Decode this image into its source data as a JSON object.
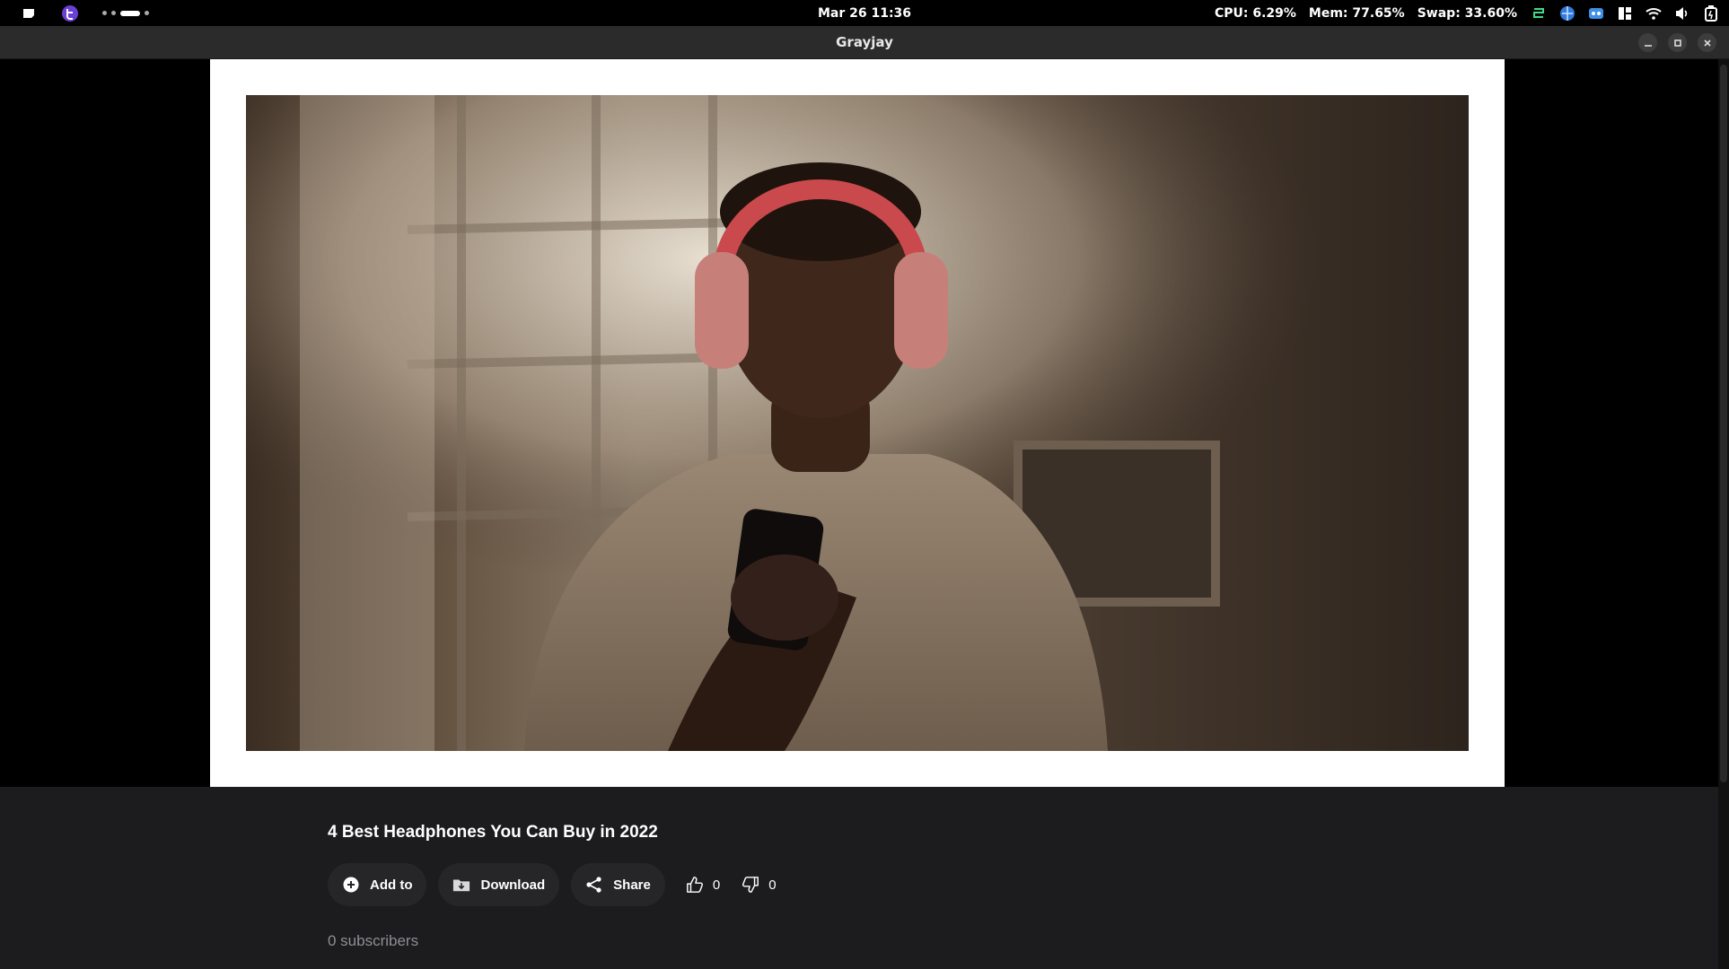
{
  "system_bar": {
    "datetime": "Mar 26  11:36",
    "cpu": "CPU: 6.29%",
    "mem": "Mem: 77.65%",
    "swap": "Swap: 33.60%"
  },
  "window": {
    "title": "Grayjay"
  },
  "video": {
    "title": "4 Best Headphones You Can Buy in 2022",
    "subscribers": "0 subscribers"
  },
  "actions": {
    "add_to": "Add to",
    "download": "Download",
    "share": "Share",
    "likes": "0",
    "dislikes": "0"
  },
  "icons": [
    "menu-icon",
    "app-launcher-icon",
    "wifi-icon",
    "volume-icon",
    "battery-icon",
    "plus-circle-icon",
    "download-folder-icon",
    "share-icon",
    "thumbs-up-icon",
    "thumbs-down-icon"
  ]
}
